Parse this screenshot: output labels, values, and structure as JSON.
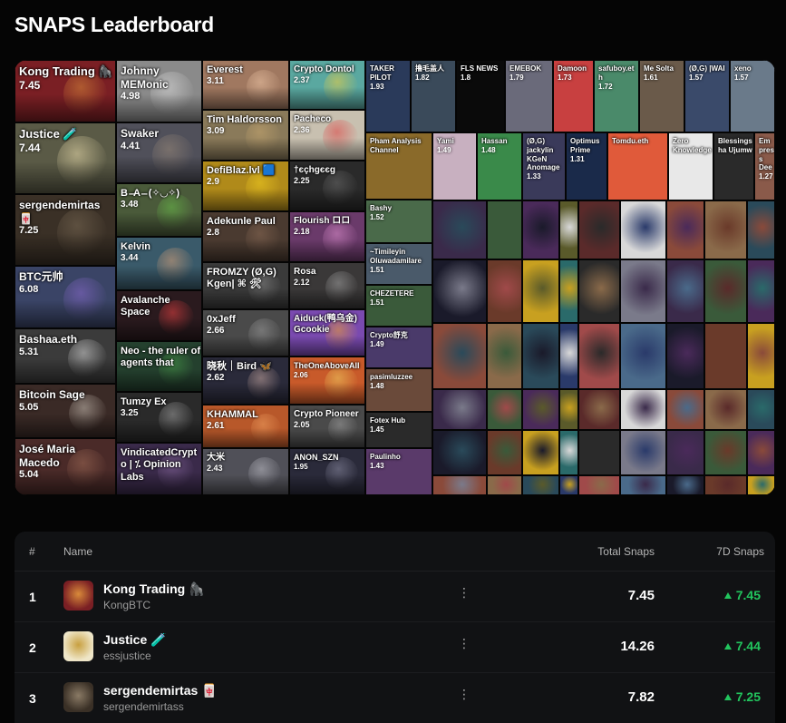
{
  "page": {
    "title": "SNAPS Leaderboard"
  },
  "mosaic": {
    "tiles": [
      {
        "name": "Kong Trading 🦍",
        "score": "7.45",
        "bg": "#7a1f24",
        "accent": "#d98a3a"
      },
      {
        "name": "Justice 🧪",
        "score": "7.44",
        "bg": "#5a5a46",
        "accent": "#f0e2b0"
      },
      {
        "name": "sergendemirtas 🀄",
        "score": "7.25",
        "bg": "#3a3026",
        "accent": "#7a6a55"
      },
      {
        "name": "BTC元帅",
        "score": "6.08",
        "bg": "#3a4466",
        "accent": "#8a6acf"
      },
      {
        "name": "Bashaa.eth",
        "score": "5.31",
        "bg": "#3b3b3b",
        "accent": "#d8d8d8"
      },
      {
        "name": "Bitcoin Sage",
        "score": "5.05",
        "bg": "#3a2a26",
        "accent": "#c9c0b5"
      },
      {
        "name": "José Maria Macedo",
        "score": "5.04",
        "bg": "#4a2a28",
        "accent": "#a06b56"
      },
      {
        "name": "Johnny MEMonic",
        "score": "4.98",
        "bg": "#8a8a8a",
        "accent": "#e0e0e0"
      },
      {
        "name": "Swaker",
        "score": "4.41",
        "bg": "#50505a",
        "accent": "#9a8a7a"
      },
      {
        "name": "B ̵ ̵A ̵ ̵ (✧◡✧)",
        "score": "3.48",
        "bg": "#4a5a3a",
        "accent": "#6abf4a"
      },
      {
        "name": "Kelvin",
        "score": "3.44",
        "bg": "#3a5a6a",
        "accent": "#d9a27a"
      },
      {
        "name": "Avalanche Space",
        "score": "",
        "bg": "#2a1a1e",
        "accent": "#e84142"
      },
      {
        "name": "Neo - the ruler of agents that",
        "score": "",
        "bg": "#24402e",
        "accent": "#4aa04a"
      },
      {
        "name": "Tumzy Ex",
        "score": "3.25",
        "bg": "#2a2a2a",
        "accent": "#a0a0a0"
      },
      {
        "name": "VindicatedCrypto | ⁒ Opinion Labs",
        "score": "",
        "bg": "#3a2a4a",
        "accent": "#8a6aa0"
      },
      {
        "name": "Everest",
        "score": "3.11",
        "bg": "#a07860",
        "accent": "#f0c8a8"
      },
      {
        "name": "Tim Haldorsson",
        "score": "3.09",
        "bg": "#8a7a5a",
        "accent": "#c8a870"
      },
      {
        "name": "DefiBlaz.lvl 🟦",
        "score": "2.9",
        "bg": "#b08a1a",
        "accent": "#f5d020"
      },
      {
        "name": "Adekunle Paul",
        "score": "2.8",
        "bg": "#4a3a30",
        "accent": "#8a6a55"
      },
      {
        "name": "FROMZY (Ø,G) Kgen| ⌘ 🛠",
        "score": "",
        "bg": "#3a3a3a",
        "accent": "#8a8a8a"
      },
      {
        "name": "0xJeff",
        "score": "2.66",
        "bg": "#4a4a4a",
        "accent": "#9a9a9a"
      },
      {
        "name": "晓秋｜Bird 🦋",
        "score": "2.62",
        "bg": "#2a2a3a",
        "accent": "#c8a8a0"
      },
      {
        "name": "KHAMMAL",
        "score": "2.61",
        "bg": "#b8582a",
        "accent": "#f0a060"
      },
      {
        "name": "大米",
        "score": "2.43",
        "bg": "#505058",
        "accent": "#c0c0c8"
      },
      {
        "name": "Crypto Dontol",
        "score": "2.37",
        "bg": "#5aa8a0",
        "accent": "#f0d040"
      },
      {
        "name": "Pacheco",
        "score": "2.36",
        "bg": "#c8c0b0",
        "accent": "#e04040"
      },
      {
        "name": "†єçhgєєg",
        "score": "2.25",
        "bg": "#2a2a2a",
        "accent": "#6a6a6a"
      },
      {
        "name": "Flourish ロロ",
        "score": "2.18",
        "bg": "#6a3a6a",
        "accent": "#e090d0"
      },
      {
        "name": "Rosa",
        "score": "2.12",
        "bg": "#3a3838",
        "accent": "#a0a0a0"
      },
      {
        "name": "Aiduck(鸭乌金) Gcookie",
        "score": "",
        "bg": "#7a4ab0",
        "accent": "#f0a030"
      },
      {
        "name": "TheOneAboveAll",
        "score": "2.06",
        "bg": "#c85a2a",
        "accent": "#f0d060"
      },
      {
        "name": "Crypto Pioneer",
        "score": "2.05",
        "bg": "#4a4a4a",
        "accent": "#a0a0a0"
      },
      {
        "name": "ANON_SZN",
        "score": "1.95",
        "bg": "#2a2a3a",
        "accent": "#8a8aa0"
      }
    ],
    "small_tiles": [
      {
        "name": "TAKER PILOT",
        "score": "1.93",
        "bg": "#2a3a5a"
      },
      {
        "name": "撸毛盖人",
        "score": "1.82",
        "bg": "#3a4a5a"
      },
      {
        "name": "FLS NEWS",
        "score": "1.8",
        "bg": "#0a0a0a"
      },
      {
        "name": "EMEBOK",
        "score": "1.79",
        "bg": "#6a6a7a"
      },
      {
        "name": "Damoon",
        "score": "1.73",
        "bg": "#c84040"
      },
      {
        "name": "safuboy.eth",
        "score": "1.72",
        "bg": "#4a8a6a"
      },
      {
        "name": "Me Solta",
        "score": "1.61",
        "bg": "#6a5a4a"
      },
      {
        "name": "(Ø,G) |WAI",
        "score": "1.57",
        "bg": "#3a4a6a"
      },
      {
        "name": "xeno",
        "score": "1.57",
        "bg": "#6a7a8a"
      },
      {
        "name": "Pham Analysis Channel",
        "score": "",
        "bg": "#8a6a2a"
      },
      {
        "name": "Yami",
        "score": "1.49",
        "bg": "#c8b0c0"
      },
      {
        "name": "Hassan",
        "score": "1.48",
        "bg": "#3a8a4a"
      },
      {
        "name": "(Ø,G) jackylin KGeN Anomage",
        "score": "1.33",
        "bg": "#3a3a5a"
      },
      {
        "name": "Optimus Prime",
        "score": "1.31",
        "bg": "#1a2a4a"
      },
      {
        "name": "Tomdu.eth",
        "score": "",
        "bg": "#e05a3a"
      },
      {
        "name": "Zero Knowledge",
        "score": "",
        "bg": "#e8e8e8"
      },
      {
        "name": "Blessingsha Ujumw",
        "score": "",
        "bg": "#2a2a2a"
      },
      {
        "name": "Empress Dee",
        "score": "1.27",
        "bg": "#8a5a4a"
      },
      {
        "name": "Bashy",
        "score": "1.52",
        "bg": "#4a6a4a"
      },
      {
        "name": "~Timileyin Oluwadamilare",
        "score": "1.51",
        "bg": "#4a5a6a"
      },
      {
        "name": "CHEZETERE",
        "score": "1.51",
        "bg": "#3a5a3a"
      },
      {
        "name": "Crypto舒克",
        "score": "1.49",
        "bg": "#4a3a6a"
      },
      {
        "name": "pasimluzzee",
        "score": "1.48",
        "bg": "#6a4a3a"
      },
      {
        "name": "Fotex Hub",
        "score": "1.45",
        "bg": "#2a2a2a"
      },
      {
        "name": "Paulinho",
        "score": "1.43",
        "bg": "#5a3a6a"
      }
    ]
  },
  "board": {
    "headers": {
      "rank": "#",
      "name": "Name",
      "total": "Total Snaps",
      "seven": "7D Snaps"
    },
    "rows": [
      {
        "rank": "1",
        "name": "Kong Trading",
        "emoji": "🦍",
        "handle": "KongBTC",
        "total": "7.45",
        "seven": "7.45",
        "avatar_bg": "#7a1f24",
        "avatar_accent": "#d98a3a"
      },
      {
        "rank": "2",
        "name": "Justice",
        "emoji": "🧪",
        "handle": "essjustice",
        "total": "14.26",
        "seven": "7.44",
        "avatar_bg": "#efe6c8",
        "avatar_accent": "#c8a040"
      },
      {
        "rank": "3",
        "name": "sergendemirtas",
        "emoji": "🀄",
        "handle": "sergendemirtass",
        "total": "7.82",
        "seven": "7.25",
        "avatar_bg": "#3a3026",
        "avatar_accent": "#8a7a65"
      }
    ],
    "menu_glyph": "⋮"
  }
}
